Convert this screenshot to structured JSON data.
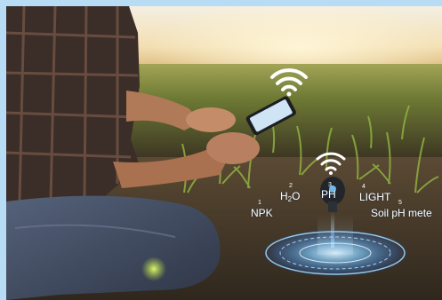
{
  "sensor_labels": {
    "npk": {
      "index": "1",
      "text": "NPK"
    },
    "h2o": {
      "index": "2",
      "text_a": "H",
      "text_sub": "2",
      "text_b": "O"
    },
    "ph": {
      "index": "3",
      "text": "PH"
    },
    "light": {
      "index": "4",
      "text": "LIGHT"
    },
    "meter": {
      "index": "5",
      "text": "Soil pH mete"
    }
  },
  "icons": [
    "wifi-icon",
    "wifi-icon",
    "smartphone-icon",
    "soil-sensor-probe-icon",
    "hologram-ring-icon"
  ],
  "colors": {
    "frame_background": "#b9dcf5",
    "sky_glow": "#f7e6c4",
    "hologram": "#6fc3ff",
    "field": "#5f6b2f"
  }
}
